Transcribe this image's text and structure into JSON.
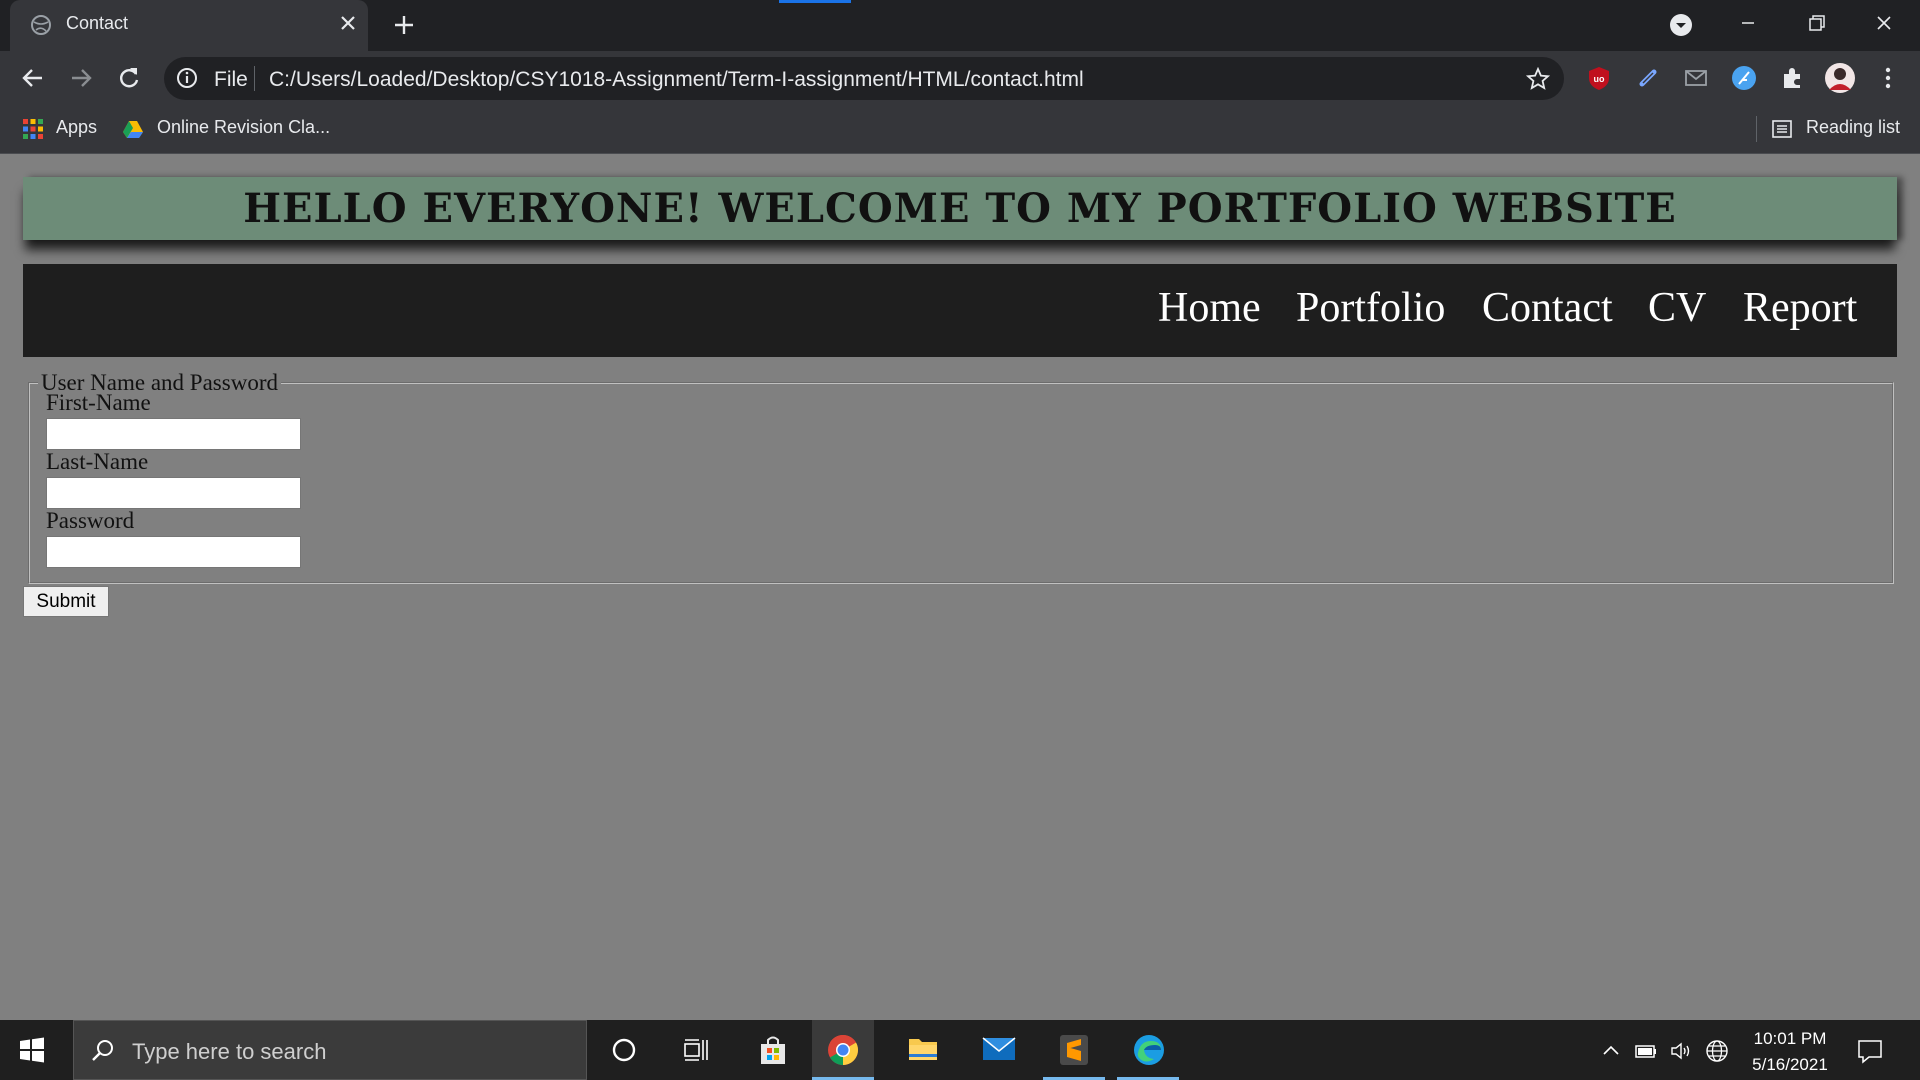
{
  "browser": {
    "tab_title": "Contact",
    "omnibox_scheme": "File",
    "url": "C:/Users/Loaded/Desktop/CSY1018-Assignment/Term-I-assignment/HTML/contact.html",
    "bookmarks": [
      {
        "label": "Apps",
        "icon": "apps-grid-icon"
      },
      {
        "label": "Online Revision Cla...",
        "icon": "google-drive-icon"
      }
    ],
    "reading_list_label": "Reading list"
  },
  "page": {
    "banner_title": "HELLO EVERYONE! WELCOME TO MY PORTFOLIO WEBSITE",
    "nav": [
      "Home",
      "Portfolio",
      "Contact",
      "CV",
      "Report"
    ],
    "form": {
      "legend": "User Name and Password",
      "fields": [
        {
          "label": "First-Name",
          "value": ""
        },
        {
          "label": "Last-Name",
          "value": ""
        },
        {
          "label": "Password",
          "value": ""
        }
      ],
      "submit_label": "Submit"
    },
    "colors": {
      "banner_bg": "#6d8c78",
      "nav_bg": "#1e1e1e",
      "page_bg": "#808080"
    }
  },
  "taskbar": {
    "search_placeholder": "Type here to search",
    "time": "10:01 PM",
    "date": "5/16/2021"
  }
}
